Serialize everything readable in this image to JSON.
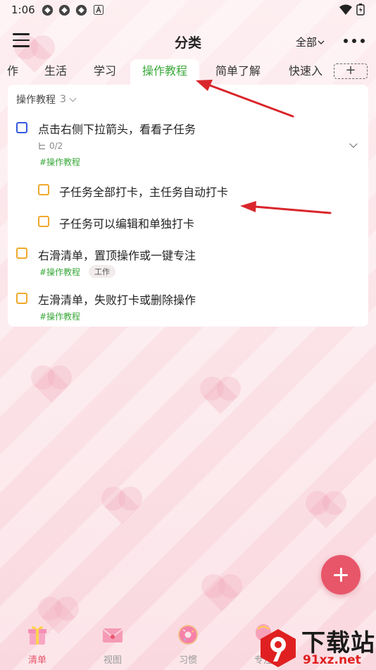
{
  "status_bar": {
    "time": "1:06"
  },
  "header": {
    "title": "分类",
    "filter_label": "全部"
  },
  "tabs": [
    {
      "label": "作"
    },
    {
      "label": "生活"
    },
    {
      "label": "学习"
    },
    {
      "label": "操作教程",
      "active": true
    },
    {
      "label": "简单了解"
    },
    {
      "label": "快速入"
    }
  ],
  "tab_add_label": "+",
  "group": {
    "name": "操作教程",
    "count": "3"
  },
  "tasks": [
    {
      "title": "点击右侧下拉箭头，看看子任务",
      "subtask_count": "0/2",
      "tag": "#操作教程"
    },
    {
      "title": "子任务全部打卡，主任务自动打卡"
    },
    {
      "title": "子任务可以编辑和单独打卡"
    },
    {
      "title": "右滑清单，置顶操作或一键专注",
      "tag": "#操作教程",
      "badge": "工作"
    },
    {
      "title": "左滑清单，失败打卡或删除操作",
      "tag": "#操作教程"
    }
  ],
  "bottom_nav": [
    {
      "label": "清单",
      "icon": "gift-box-icon",
      "active": true
    },
    {
      "label": "视图",
      "icon": "envelope-icon"
    },
    {
      "label": "习惯",
      "icon": "donut-icon"
    },
    {
      "label": "专注",
      "icon": "balloon-icon"
    }
  ],
  "watermark": {
    "text_main": "下载站",
    "text_sub": "91xz.net",
    "logo_text": "9"
  },
  "colors": {
    "accent_green": "#3aa83a",
    "checkbox_orange": "#f0a92c",
    "checkbox_blue": "#3559e0",
    "fab_red": "#e8566a",
    "annotation_arrow": "#d9262c"
  }
}
